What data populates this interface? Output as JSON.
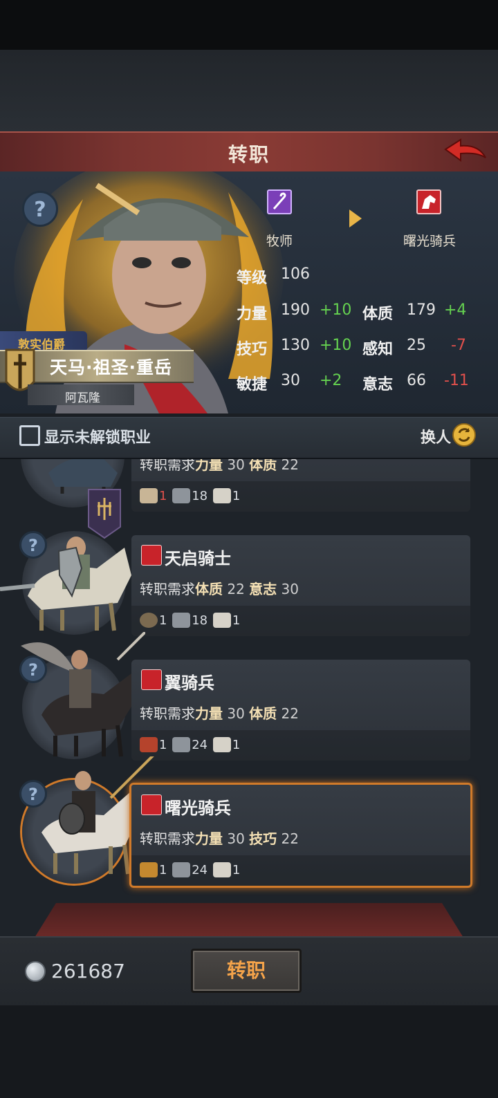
{
  "header": {
    "title": "转职"
  },
  "current_class": {
    "name": "牧师",
    "icon": "staff-icon",
    "color": "#7b3fb8"
  },
  "target_class": {
    "name": "曙光骑兵",
    "icon": "horse-head-icon",
    "color": "#c8232a"
  },
  "hero": {
    "rank": "敦实伯爵",
    "name": "天马·祖圣·重岳",
    "subtitle": "阿瓦隆"
  },
  "stats": {
    "level_label": "等级",
    "level": "106",
    "strength_label": "力量",
    "strength": "190",
    "strength_delta": "+10",
    "constitution_label": "体质",
    "constitution": "179",
    "constitution_delta": "+4",
    "skill_label": "技巧",
    "skill": "130",
    "skill_delta": "+10",
    "perception_label": "感知",
    "perception": "25",
    "perception_delta": "-7",
    "agility_label": "敏捷",
    "agility": "30",
    "agility_delta": "+2",
    "will_label": "意志",
    "will": "66",
    "will_delta": "-11"
  },
  "options": {
    "show_locked_label": "显示未解锁职业",
    "swap_label": "换人"
  },
  "classes": [
    {
      "title": "",
      "req_prefix": "转职需求",
      "req1_name": "力量",
      "req1_val": "30",
      "req2_name": "体质",
      "req2_val": "22",
      "mat1_icon": "skull-icon",
      "mat1": "1",
      "mat2_icon": "iron-ingot-icon",
      "mat2": "18",
      "mat3_icon": "horse-icon",
      "mat3": "1"
    },
    {
      "title": "天启骑士",
      "req_prefix": "转职需求",
      "req1_name": "体质",
      "req1_val": "22",
      "req2_name": "意志",
      "req2_val": "30",
      "mat1_icon": "ring-icon",
      "mat1": "1",
      "mat2_icon": "iron-ingot-icon",
      "mat2": "18",
      "mat3_icon": "horse-icon",
      "mat3": "1"
    },
    {
      "title": "翼骑兵",
      "req_prefix": "转职需求",
      "req1_name": "力量",
      "req1_val": "30",
      "req2_name": "体质",
      "req2_val": "22",
      "mat1_icon": "medal-icon",
      "mat1": "1",
      "mat2_icon": "iron-ingot-icon",
      "mat2": "24",
      "mat3_icon": "horse-icon",
      "mat3": "1"
    },
    {
      "title": "曙光骑兵",
      "req_prefix": "转职需求",
      "req1_name": "力量",
      "req1_val": "30",
      "req2_name": "技巧",
      "req2_val": "22",
      "mat1_icon": "emblem-icon",
      "mat1": "1",
      "mat2_icon": "iron-ingot-icon",
      "mat2": "24",
      "mat3_icon": "horse-icon",
      "mat3": "1"
    }
  ],
  "footer": {
    "currency": "261687",
    "currency_icon": "silver-coin-icon",
    "action_label": "转职"
  }
}
